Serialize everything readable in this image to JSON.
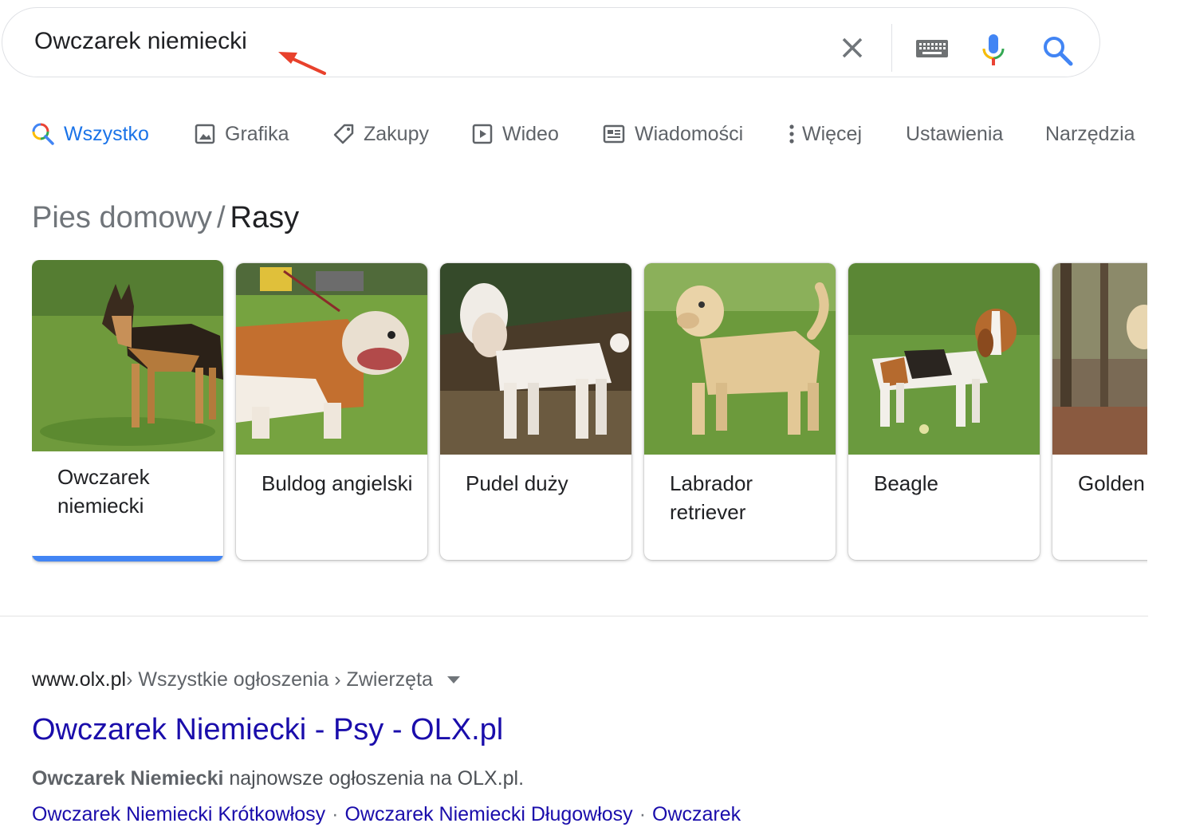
{
  "search": {
    "query": "Owczarek niemiecki"
  },
  "tabs": [
    {
      "label": "Wszystko",
      "icon": "search-icon",
      "active": true
    },
    {
      "label": "Grafika",
      "icon": "image-icon"
    },
    {
      "label": "Zakupy",
      "icon": "tag-icon"
    },
    {
      "label": "Wideo",
      "icon": "play-icon"
    },
    {
      "label": "Wiadomości",
      "icon": "news-icon"
    },
    {
      "label": "Więcej",
      "icon": "more-vert-icon"
    },
    {
      "label": "Ustawienia"
    },
    {
      "label": "Narzędzia"
    }
  ],
  "knowledge": {
    "parent": "Pies domowy",
    "separator": "/",
    "current": "Rasy"
  },
  "breeds": [
    {
      "name": "Owczarek niemiecki",
      "selected": true
    },
    {
      "name": "Buldog angielski"
    },
    {
      "name": "Pudel duży"
    },
    {
      "name": "Labrador retriever"
    },
    {
      "name": "Beagle"
    },
    {
      "name": "Golden retriever"
    }
  ],
  "result": {
    "domain": "www.olx.pl",
    "path": " › Wszystkie ogłoszenia › Zwierzęta",
    "title": "Owczarek Niemiecki - Psy - OLX.pl",
    "snippet_bold": "Owczarek Niemiecki",
    "snippet_rest": " najnowsze ogłoszenia na OLX.pl.",
    "sitelinks": [
      "Owczarek Niemiecki Krótkowłosy",
      "Owczarek Niemiecki Długowłosy",
      "Owczarek"
    ],
    "sitelink_separator": "·"
  },
  "colors": {
    "link": "#1a0dab",
    "active_tab": "#1a73e8",
    "selection_bar": "#4285f4",
    "arrow": "#e8412c"
  }
}
